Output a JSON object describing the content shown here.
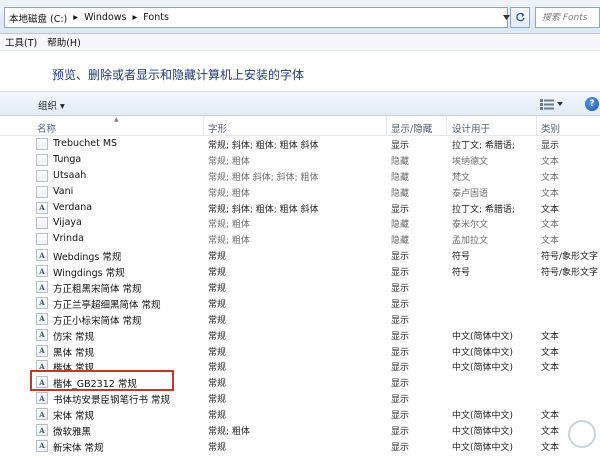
{
  "address_bar": {
    "segments": [
      "本地磁盘 (C:)",
      "Windows",
      "Fonts"
    ],
    "search_placeholder": "搜索 Fonts"
  },
  "menu": [
    "工具(T)",
    "帮助(H)"
  ],
  "header": {
    "title": "预览、删除或者显示和隐藏计算机上安装的字体"
  },
  "toolbar": {
    "organize_label": "组织 ▾"
  },
  "columns": [
    "名称",
    "字形",
    "显示/隐藏",
    "设计用于",
    "类别"
  ],
  "rows": [
    {
      "name": "Trebuchet MS",
      "style": "常规; 斜体; 粗体; 粗体 斜体",
      "show": "显示",
      "design": "拉丁文; 希腊语;",
      "cat": "显示",
      "icon": "file",
      "dim": false
    },
    {
      "name": "Tunga",
      "style": "常规; 粗体",
      "show": "隐藏",
      "design": "埃纳德文",
      "cat": "文本",
      "icon": "file",
      "dim": true
    },
    {
      "name": "Utsaah",
      "style": "常规; 粗体 斜体; 斜体; 粗体",
      "show": "隐藏",
      "design": "梵文",
      "cat": "文本",
      "icon": "file",
      "dim": true
    },
    {
      "name": "Vani",
      "style": "常规; 粗体",
      "show": "隐藏",
      "design": "泰卢固语",
      "cat": "文本",
      "icon": "file",
      "dim": true
    },
    {
      "name": "Verdana",
      "style": "常规; 斜体; 粗体; 粗体 斜体",
      "show": "显示",
      "design": "拉丁文; 希腊语;",
      "cat": "文本",
      "icon": "A",
      "dim": false
    },
    {
      "name": "Vijaya",
      "style": "常规; 粗体",
      "show": "隐藏",
      "design": "泰米尔文",
      "cat": "文本",
      "icon": "file",
      "dim": true
    },
    {
      "name": "Vrinda",
      "style": "常规; 粗体",
      "show": "隐藏",
      "design": "孟加拉文",
      "cat": "文本",
      "icon": "file",
      "dim": true
    },
    {
      "name": "Webdings 常规",
      "style": "常规",
      "show": "显示",
      "design": "符号",
      "cat": "符号/象形文字",
      "icon": "A",
      "dim": false
    },
    {
      "name": "Wingdings 常规",
      "style": "常规",
      "show": "显示",
      "design": "符号",
      "cat": "符号/象形文字",
      "icon": "A",
      "dim": false
    },
    {
      "name": "方正粗黑宋简体 常规",
      "style": "常规",
      "show": "显示",
      "design": "",
      "cat": "",
      "icon": "A",
      "dim": false
    },
    {
      "name": "方正兰亭超细黑简体 常规",
      "style": "常规",
      "show": "显示",
      "design": "",
      "cat": "",
      "icon": "A",
      "dim": false
    },
    {
      "name": "方正小标宋简体 常规",
      "style": "常规",
      "show": "显示",
      "design": "",
      "cat": "",
      "icon": "A",
      "dim": false
    },
    {
      "name": "仿宋 常规",
      "style": "常规",
      "show": "显示",
      "design": "中文(简体中文)",
      "cat": "文本",
      "icon": "A",
      "dim": false
    },
    {
      "name": "黑体 常规",
      "style": "常规",
      "show": "显示",
      "design": "中文(简体中文)",
      "cat": "文本",
      "icon": "A",
      "dim": false
    },
    {
      "name": "楷体 常规",
      "style": "常规",
      "show": "显示",
      "design": "中文(简体中文)",
      "cat": "文本",
      "icon": "A",
      "dim": false
    },
    {
      "name": "楷体_GB2312 常规",
      "style": "常规",
      "show": "显示",
      "design": "",
      "cat": "",
      "icon": "A",
      "dim": false
    },
    {
      "name": "书体坊安景臣钢笔行书 常规",
      "style": "常规",
      "show": "显示",
      "design": "",
      "cat": "",
      "icon": "A",
      "dim": false
    },
    {
      "name": "宋体 常规",
      "style": "常规",
      "show": "显示",
      "design": "中文(简体中文)",
      "cat": "文本",
      "icon": "A",
      "dim": false
    },
    {
      "name": "微软雅黑",
      "style": "常规; 粗体",
      "show": "显示",
      "design": "中文(简体中文)",
      "cat": "文本",
      "icon": "A",
      "dim": false
    },
    {
      "name": "新宋体 常规",
      "style": "常规",
      "show": "显示",
      "design": "中文(简体中文)",
      "cat": "文本",
      "icon": "A",
      "dim": false
    }
  ],
  "colors": {
    "highlight": "#c0392b",
    "title": "#1e3a78",
    "header_text": "#4c607a"
  }
}
